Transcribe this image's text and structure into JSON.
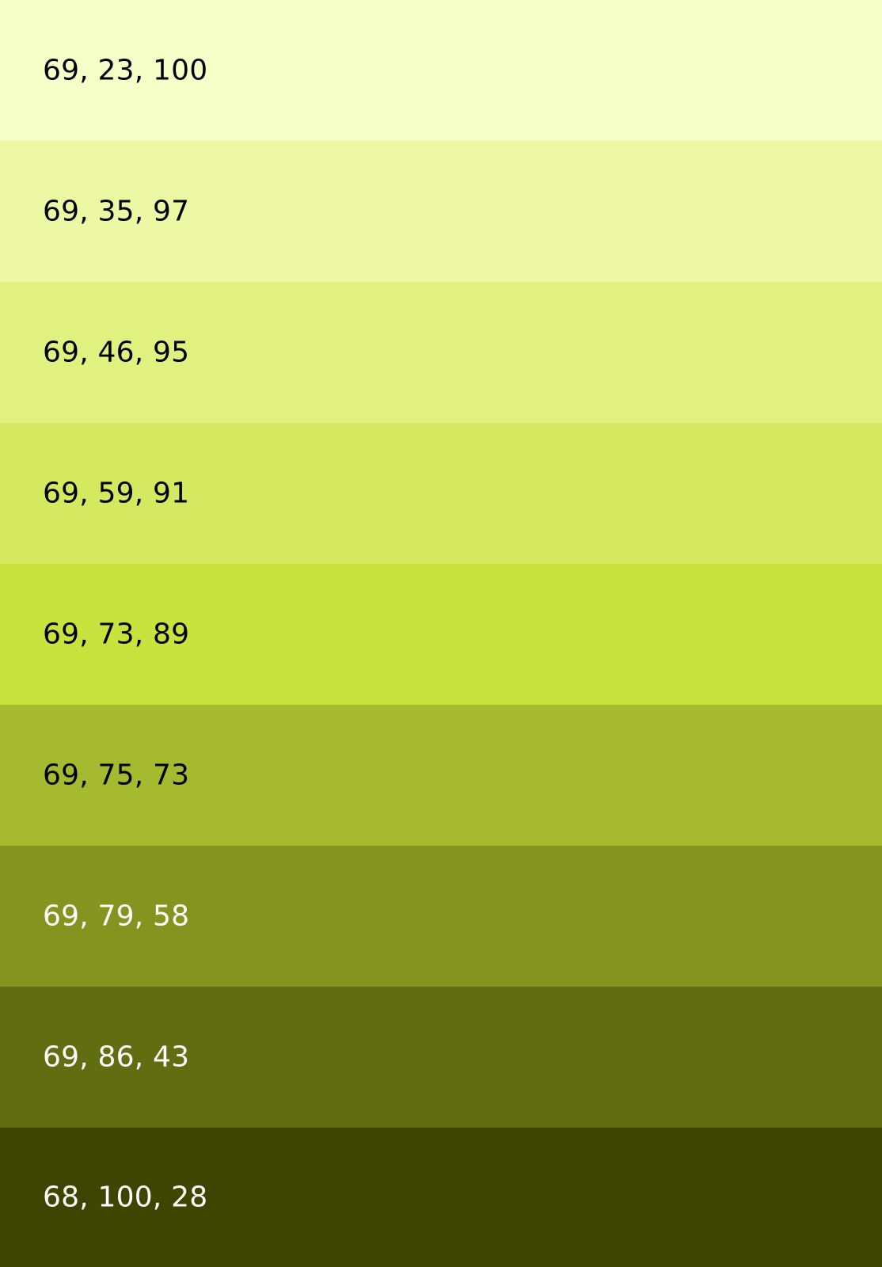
{
  "swatches": [
    {
      "label": "69, 23, 100",
      "bg": "#f6ffc8",
      "fg": "#000000"
    },
    {
      "label": "69, 35, 97",
      "bg": "#ecf8a4",
      "fg": "#000000"
    },
    {
      "label": "69, 46, 95",
      "bg": "#e0f180",
      "fg": "#000000"
    },
    {
      "label": "69, 59, 91",
      "bg": "#d4e860",
      "fg": "#000000"
    },
    {
      "label": "69, 73, 89",
      "bg": "#c9e33e",
      "fg": "#000000"
    },
    {
      "label": "69, 75, 73",
      "bg": "#a5ba2e",
      "fg": "#000000"
    },
    {
      "label": "69, 79, 58",
      "bg": "#83951f",
      "fg": "#ffffff"
    },
    {
      "label": "69, 86, 43",
      "bg": "#606d10",
      "fg": "#ffffff"
    },
    {
      "label": "68, 100, 28",
      "bg": "#3d4501",
      "fg": "#ffffff"
    }
  ]
}
